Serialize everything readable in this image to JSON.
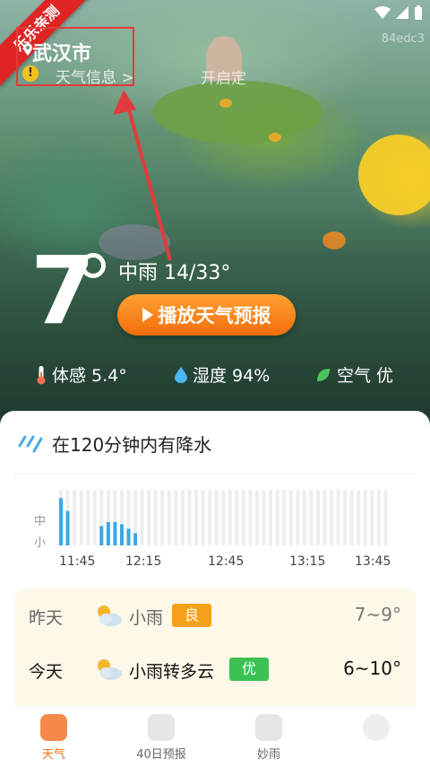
{
  "watermark": "乐乐亲测",
  "status_code": "84edc3",
  "location": {
    "city": "武汉市",
    "info_link": "天气信息 >",
    "open_text": "开启定"
  },
  "current": {
    "temp": "7",
    "condition": "中雨",
    "range": "14/33°",
    "play_label": "播放天气预报"
  },
  "metrics": {
    "feels": "体感 5.4°",
    "humidity": "湿度 94%",
    "air": "空气 优"
  },
  "rain": {
    "title": "在120分钟内有降水",
    "y_labels": [
      "中",
      "小"
    ],
    "x_ticks": [
      "11:45",
      "12:15",
      "12:45",
      "13:15",
      "13:45"
    ],
    "intensity": [
      0.85,
      0.62,
      0,
      0,
      0,
      0,
      0.35,
      0.42,
      0.42,
      0.38,
      0.3,
      0.22,
      0,
      0,
      0,
      0,
      0,
      0,
      0,
      0,
      0,
      0,
      0,
      0,
      0,
      0,
      0,
      0,
      0,
      0,
      0,
      0,
      0,
      0,
      0,
      0,
      0,
      0,
      0,
      0,
      0,
      0,
      0,
      0,
      0,
      0,
      0,
      0,
      0
    ]
  },
  "daily": [
    {
      "day": "昨天",
      "cond": "小雨",
      "aqi": "良",
      "aqi_color": "#f7a11a",
      "range": "7~9°"
    },
    {
      "day": "今天",
      "cond": "小雨转多云",
      "aqi": "优",
      "aqi_color": "#3cc252",
      "range": "6~10°"
    }
  ],
  "tabs": [
    {
      "label": "天气",
      "active": true
    },
    {
      "label": "40日预报",
      "active": false
    },
    {
      "label": "妙雨",
      "active": false
    },
    {
      "label": "",
      "active": false
    }
  ],
  "colors": {
    "accent": "#f36d0c",
    "rain_bar": "#3aa8e6",
    "bar_empty": "#eeeeee",
    "alert": "#e23b3b"
  }
}
